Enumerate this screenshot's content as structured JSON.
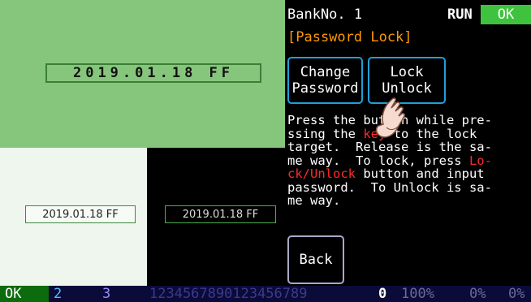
{
  "preview": {
    "large_date": "2019.01.18 FF",
    "date_light": "2019.01.18 FF",
    "date_dark": "2019.01.18 FF"
  },
  "panel": {
    "bank_label": "BankNo. 1",
    "run_label": "RUN",
    "ok_label": "OK",
    "subtitle": "[Password Lock]",
    "change_password": {
      "line1": "Change",
      "line2": "Password"
    },
    "lock_unlock": {
      "line1": "Lock",
      "line2": "Unlock"
    },
    "description": {
      "l1": "Press the button while pre-",
      "l2a": "ssing the ",
      "l2red": "key",
      "l2b": " to the lock",
      "l3": "target.  Release is the sa-",
      "l4a": "me way.  To lock, press ",
      "l4red": "Lo-",
      "l5red": "ck/Unlock",
      "l5b": " button and input",
      "l6": "password.  To Unlock is sa-",
      "l7": "me way."
    },
    "back": "Back"
  },
  "statusbar": {
    "ok": "OK",
    "ch2": "2",
    "ch3": "3",
    "digits": "1234567890123456789",
    "zero": "0",
    "p1": "100%",
    "p2": "0%",
    "p3": "0%"
  },
  "colors": {
    "green_preview": "#86c67c",
    "ok_green": "#3fc33f",
    "button_border": "#1ea0d8",
    "accent_orange": "#ff9a00",
    "red_text": "#ff2a2a"
  }
}
